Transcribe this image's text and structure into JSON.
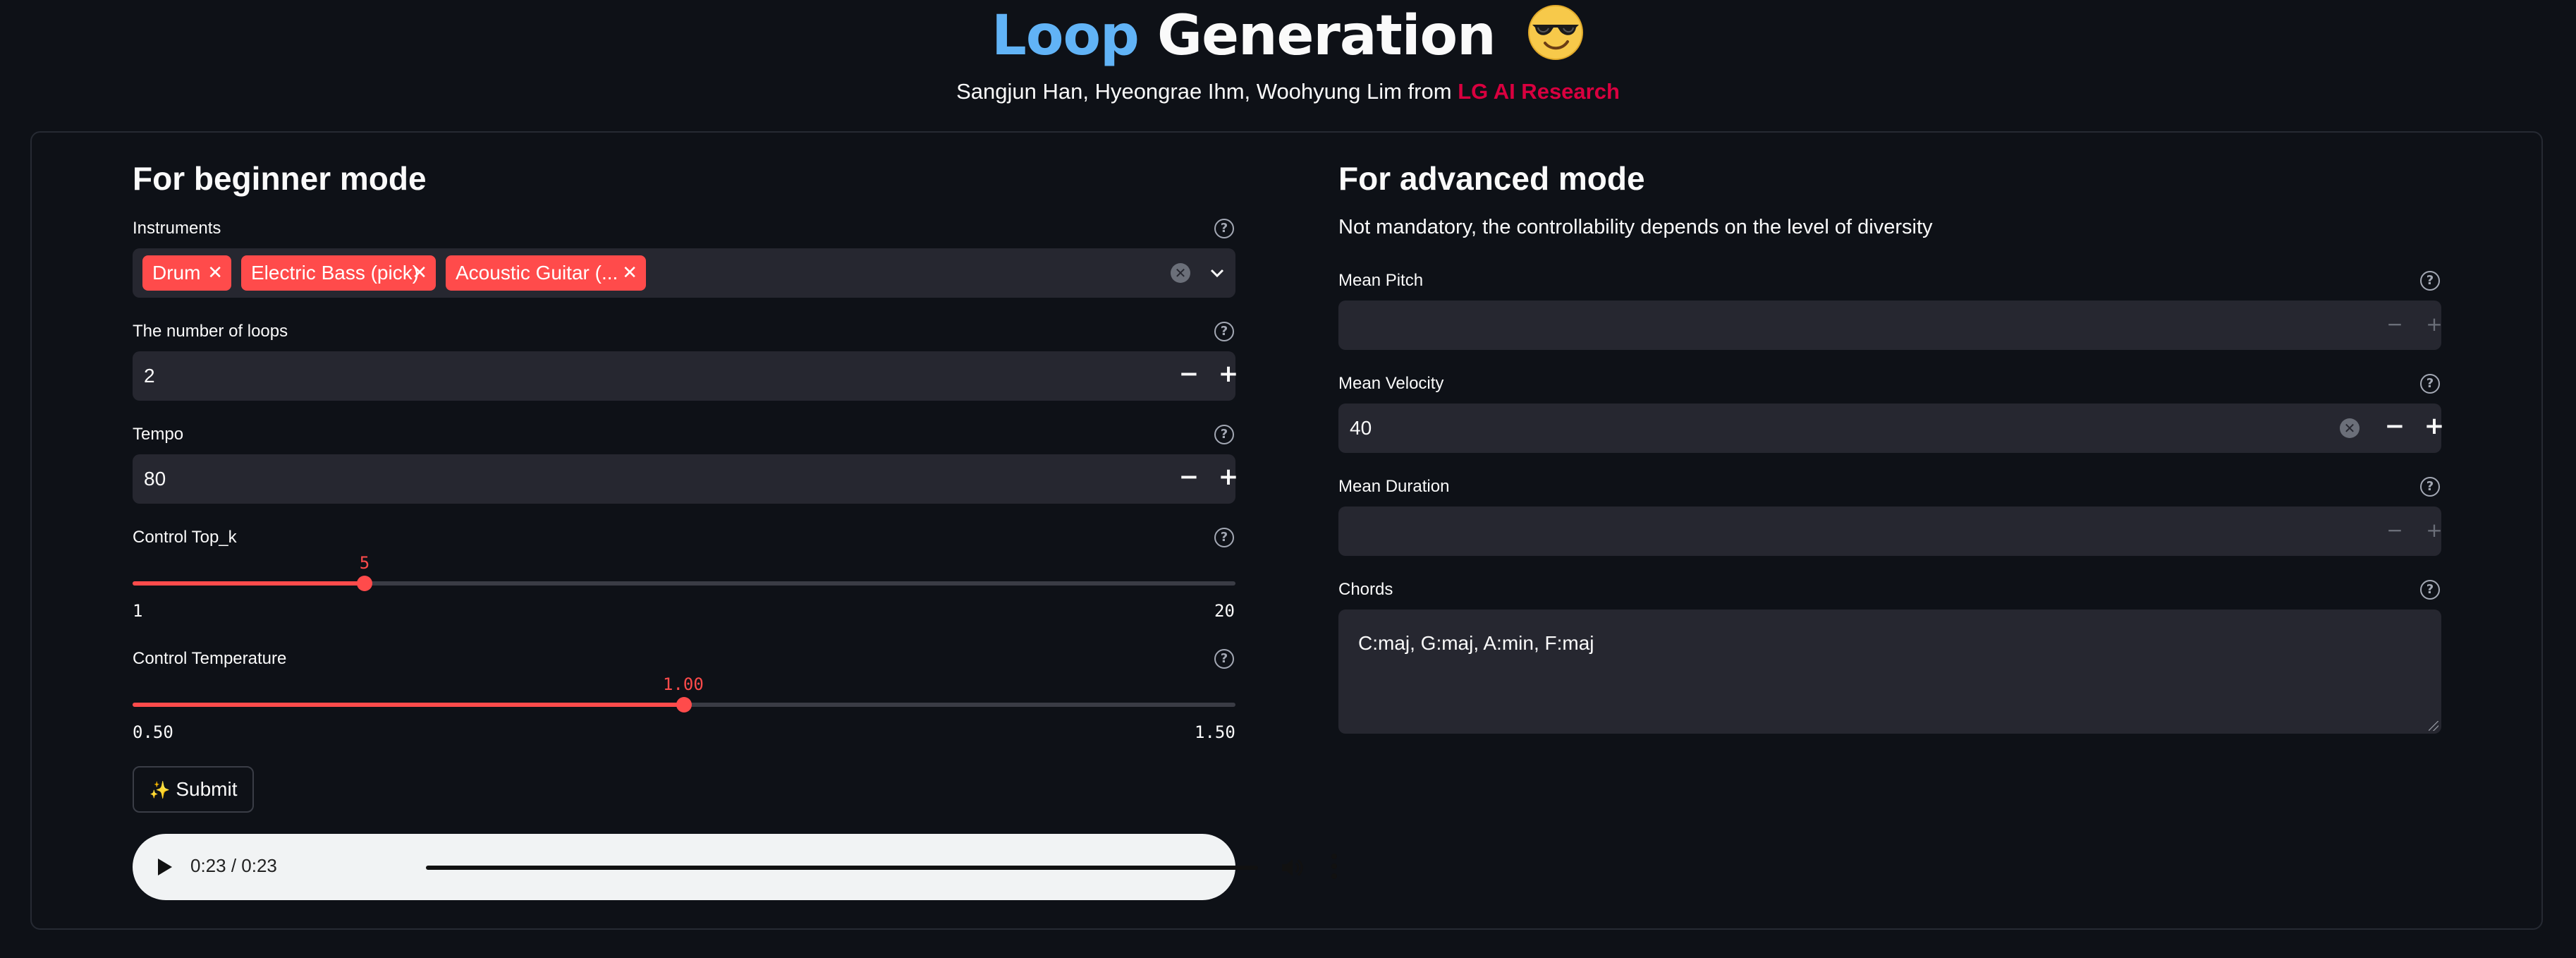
{
  "header": {
    "title_accent": "Loop",
    "title_rest": "Generation",
    "emoji": "sunglasses-emoji",
    "authors": "Sangjun Han, Hyeongrae Ihm, Woohyung Lim from",
    "org": "LG AI Research"
  },
  "beginner": {
    "heading": "For beginner mode",
    "instruments": {
      "label": "Instruments",
      "tags": [
        "Drum",
        "Electric Bass (pick)",
        "Acoustic Guitar (..."
      ]
    },
    "loops": {
      "label": "The number of loops",
      "value": "2"
    },
    "tempo": {
      "label": "Tempo",
      "value": "80"
    },
    "top_k": {
      "label": "Control Top_k",
      "value": "5",
      "min": "1",
      "max": "20",
      "fraction": 0.2105
    },
    "temperature": {
      "label": "Control Temperature",
      "value": "1.00",
      "min": "0.50",
      "max": "1.50",
      "fraction": 0.5
    },
    "submit_label": "Submit",
    "audio": {
      "time": "0:23 / 0:23",
      "progress": 1.0
    }
  },
  "advanced": {
    "heading": "For advanced mode",
    "description": "Not mandatory, the controllability depends on the level of diversity",
    "mean_pitch": {
      "label": "Mean Pitch",
      "value": ""
    },
    "mean_velocity": {
      "label": "Mean Velocity",
      "value": "40"
    },
    "mean_duration": {
      "label": "Mean Duration",
      "value": ""
    },
    "chords": {
      "label": "Chords",
      "value": "C:maj, G:maj, A:min, F:maj"
    }
  },
  "colors": {
    "background": "#0e1117",
    "accent_red": "#ff4b4b",
    "title_blue": "#61b3f6",
    "org_red": "#d9003f",
    "field_bg": "#262730"
  }
}
